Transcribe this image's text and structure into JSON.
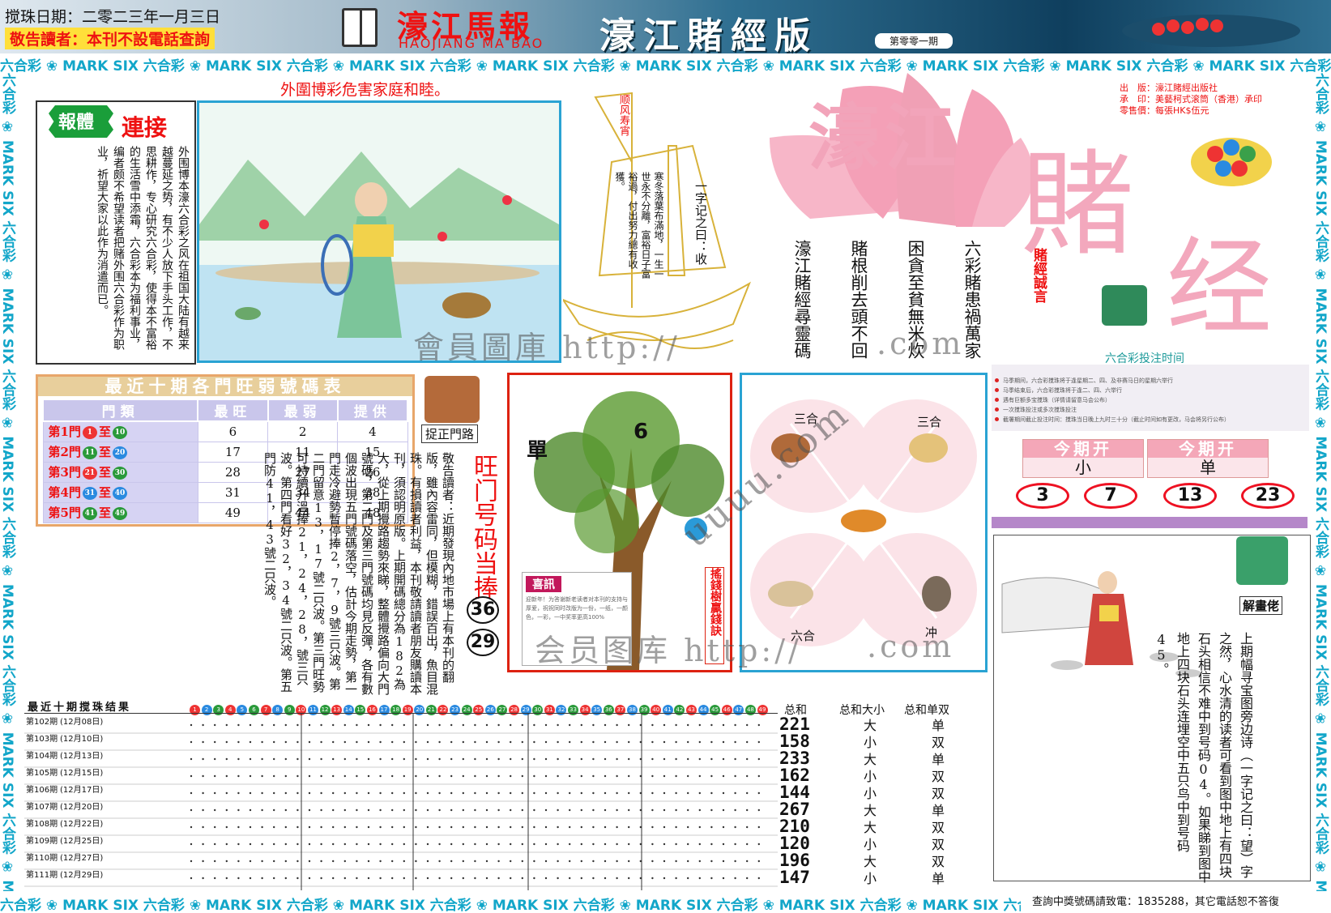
{
  "header": {
    "date": "搅珠日期：二零二三年一月三日",
    "notice": "敬告讀者：本刊不設電話查詢",
    "paper_name": "濠江馬報",
    "paper_pinyin": "HAOJIANG MA BAO",
    "edition": "濠江賭經版",
    "issue": "第零零一期"
  },
  "strip_text": "六合彩 ❀ MARK SIX 六合彩 ❀ MARK SIX 六合彩 ❀ MARK SIX 六合彩 ❀ MARK SIX 六合彩 ❀ MARK SIX 六合彩 ❀ MARK SIX 六合彩 ❀ MARK SIX 六合彩 ❀ MARK SIX 六合彩 ❀ MARK SIX 六合彩 ❀ MARK SIX",
  "warning": "外圍博彩危害家庭和睦。",
  "story": {
    "badge": "報體",
    "title": "連接",
    "text": "外围博本濠六合彩之风在祖国大陆有越来越蔓延之势，有不少人放下手头工作，不思耕作，专心研究六合彩，使得本不富裕的生活雪中添霜，六合彩本为福利事业，编者颇不希望读者把赌外围六合彩作为职业，祈望大家以此作为消遣而已。"
  },
  "boat": {
    "flag": "顺风寿宵",
    "title": "一字记之曰：收",
    "text": "寒冬落葉布滿地，一生一世永不分離，富裕日子富裕過，付出努力總有收獲。"
  },
  "logo": {
    "word1": "濠江",
    "word2": "賭",
    "word3": "经",
    "side": "賭經誠言"
  },
  "publisher": {
    "line1": "出　版：濠江賭經出版社",
    "line2": "承　印：美藝柯式滚筒（香港）承印",
    "line3": "零售價：每張HK$伍元"
  },
  "poem": [
    "六彩賭患禍萬家",
    "困貪至貧無米炊",
    "賭根削去頭不回",
    "濠江賭經尋靈碼"
  ],
  "bet_time": {
    "title": "六合彩投注时间",
    "lines": [
      "马季期间，六合彩搅珠将于逢星期二、四、及非赛马日的星期六举行",
      "马季结束后，六合彩搅珠将于逢二、四、六举行",
      "遇有巨额多宝搅珠（详情请留意马会公布）",
      "一次搅珠投注或多次搅珠投注",
      "截署期间截止投注时间：搅珠当日晚上九时三十分（截止时间如有更改，马会将另行公布）"
    ]
  },
  "open_this": [
    {
      "label": "今期开",
      "value": "小"
    },
    {
      "label": "今期开",
      "value": "单"
    }
  ],
  "open_numbers": [
    "3",
    "7",
    "13",
    "23"
  ],
  "door_table": {
    "title": "最近十期各門旺弱號碼表",
    "headers": [
      "門類",
      "最旺",
      "最弱",
      "提供"
    ],
    "rows": [
      {
        "door": "第1門",
        "from": "1",
        "to": "10",
        "hot": "6",
        "cold": "2",
        "give": "4"
      },
      {
        "door": "第2門",
        "from": "11",
        "to": "20",
        "hot": "17",
        "cold": "11",
        "give": "15"
      },
      {
        "door": "第3門",
        "from": "21",
        "to": "30",
        "hot": "28",
        "cold": "27",
        "give": "26"
      },
      {
        "door": "第4門",
        "from": "31",
        "to": "40",
        "hot": "31",
        "cold": "34",
        "give": "38"
      },
      {
        "door": "第5門",
        "from": "41",
        "to": "49",
        "hot": "49",
        "cold": "44",
        "give": "48"
      }
    ],
    "to_word": "至"
  },
  "gate": {
    "label": "捉正門路",
    "hot_title": "旺门号码当捧",
    "hot_numbers": [
      "36",
      "29"
    ]
  },
  "column_text": "敬告讀者：近期發現內地市場上有本刊的翻版，雖內容雷同，但模糊，錯誤百出，魚目混珠。有損讀者利益，本刊敬請讀者朋友購讀本刊，須認明原版。上期開碼總分為182為大，從上期攪路趨勢來睇，整體攪路偏向大門號碼，第二門及第三門號碼均見反彈，各有數個波出現五門號碼落空，估計今期走勢，第一門走冷避勢暫停捧2，7，9號三只波。第二門留意13，17號二只波。第三門旺勢可持續升溫捧21，24，28，號三只波。第四門看好32，34號二只波。第五門防41，43號二只波。",
  "tree": {
    "left_label": "單",
    "right_label": "6",
    "side": "搖錢樹贏錢訣",
    "card_title": "喜訊",
    "card_text": "迎新年！为答谢新老读者对本刊的支持与厚爱，祝祝同时改版为一份，一纸，一颜色，一彩，一中奖率更高100%"
  },
  "zodiac": {
    "tl": "三合",
    "tr": "三合",
    "bl": "六合",
    "br": "冲"
  },
  "results": {
    "title": "最近十期搅珠结果",
    "ball_numbers": [
      "1",
      "2",
      "3",
      "4",
      "5",
      "6",
      "7",
      "8",
      "9",
      "10",
      "11",
      "12",
      "13",
      "14",
      "15",
      "16",
      "17",
      "18",
      "19",
      "20",
      "21",
      "22",
      "23",
      "24",
      "25",
      "26",
      "27",
      "28",
      "29",
      "30",
      "31",
      "32",
      "33",
      "34",
      "35",
      "36",
      "37",
      "38",
      "39",
      "40",
      "41",
      "42",
      "43",
      "44",
      "45",
      "46",
      "47",
      "48",
      "49"
    ],
    "sum_header": "总和",
    "size_header": "总和大小",
    "oddeven_header": "总和单双",
    "rows": [
      {
        "period": "第102期",
        "date": "(12月08日)",
        "sum": "221",
        "size": "大",
        "oe": "单"
      },
      {
        "period": "第103期",
        "date": "(12月10日)",
        "sum": "158",
        "size": "小",
        "oe": "双"
      },
      {
        "period": "第104期",
        "date": "(12月13日)",
        "sum": "233",
        "size": "大",
        "oe": "单"
      },
      {
        "period": "第105期",
        "date": "(12月15日)",
        "sum": "162",
        "size": "小",
        "oe": "双"
      },
      {
        "period": "第106期",
        "date": "(12月17日)",
        "sum": "144",
        "size": "小",
        "oe": "双"
      },
      {
        "period": "第107期",
        "date": "(12月20日)",
        "sum": "267",
        "size": "大",
        "oe": "单"
      },
      {
        "period": "第108期",
        "date": "(12月22日)",
        "sum": "210",
        "size": "大",
        "oe": "双"
      },
      {
        "period": "第109期",
        "date": "(12月25日)",
        "sum": "120",
        "size": "小",
        "oe": "双"
      },
      {
        "period": "第110期",
        "date": "(12月27日)",
        "sum": "196",
        "size": "大",
        "oe": "双"
      },
      {
        "period": "第111期",
        "date": "(12月29日)",
        "sum": "147",
        "size": "小",
        "oe": "单"
      }
    ]
  },
  "right_story": {
    "label": "解畫佬",
    "text": "上期幅寻宝图旁边诗（一字记之曰：望）字之然，心水清的读者可看到图中地上有四块石头相信不难中到号码04。如果睇到图中地上四块石头连埋空中五只鸟中到号码45。"
  },
  "contact": "查詢中獎號碼請致電：1835288，其它電話恕不答復",
  "watermarks": [
    "會員圖庫 http://",
    ".com",
    "会员图库 http://",
    ".com",
    "uuuu.com"
  ],
  "colors": {
    "red": "#e11111",
    "teal": "#12a6c9",
    "pink": "#f7b6c8",
    "blue": "#2aa3d3"
  }
}
